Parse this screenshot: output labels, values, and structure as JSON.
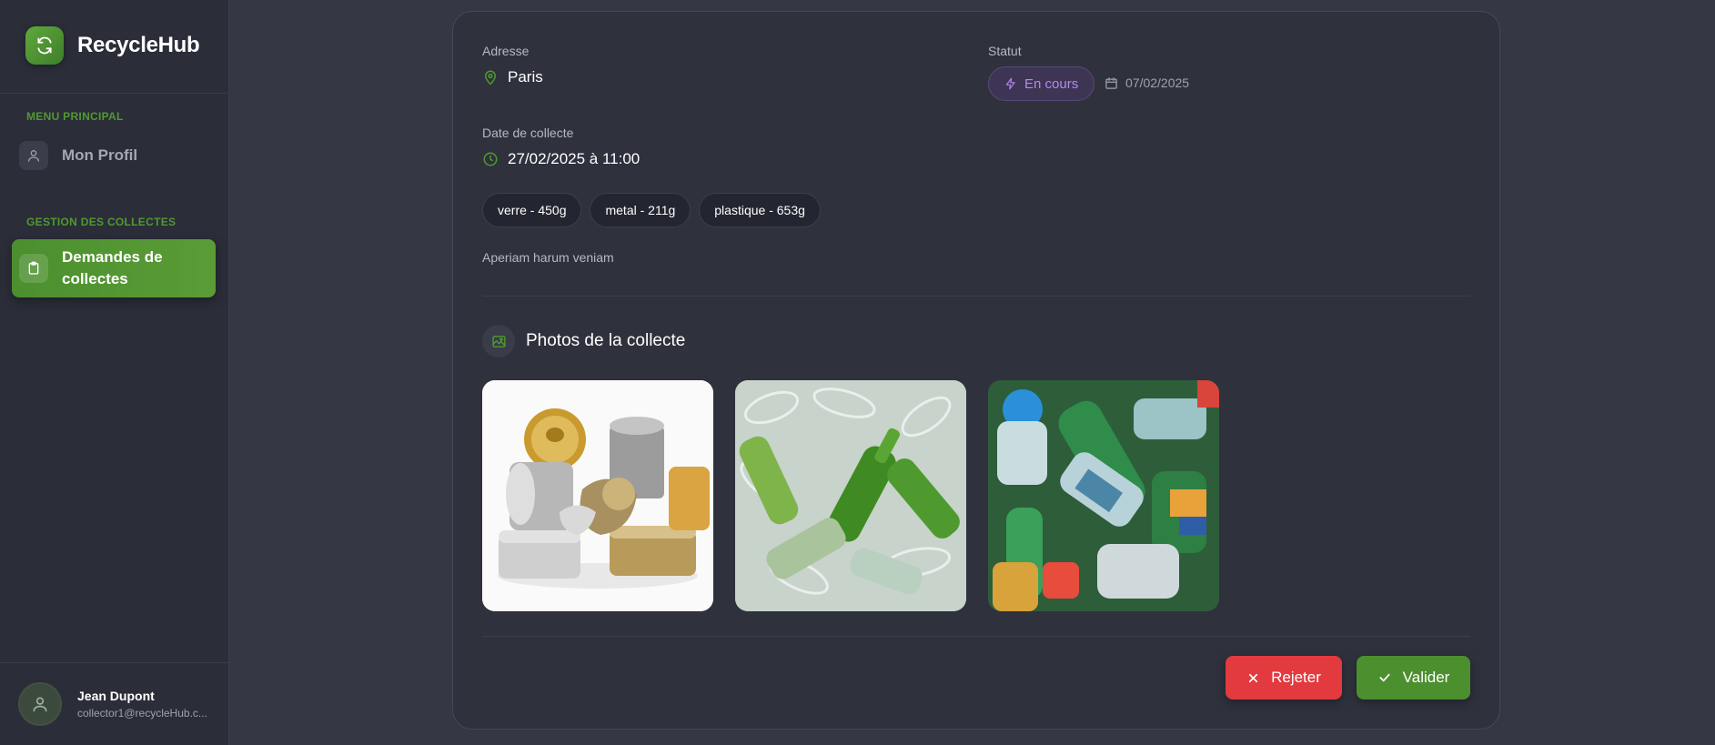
{
  "brand": {
    "name": "RecycleHub",
    "accent": "#4f9a2e"
  },
  "sidebar": {
    "section_main": "MENU PRINCIPAL",
    "profile_label": "Mon Profil",
    "section_collects": "GESTION DES COLLECTES",
    "active_item_label": "Demandes de collectes"
  },
  "user": {
    "name": "Jean Dupont",
    "email": "collector1@recycleHub.c..."
  },
  "request": {
    "address_label": "Adresse",
    "address_value": "Paris",
    "status_label": "Statut",
    "status_value": "En cours",
    "status_color": "#b488f2",
    "created_date": "07/02/2025",
    "collect_date_label": "Date de collecte",
    "collect_date_value": "27/02/2025 à 11:00",
    "materials": [
      {
        "label": "verre - 450g"
      },
      {
        "label": "metal - 211g"
      },
      {
        "label": "plastique - 653g"
      }
    ],
    "description": "Aperiam harum veniam"
  },
  "photos": {
    "title": "Photos de la collecte",
    "items": [
      {
        "name": "metal-cans-photo"
      },
      {
        "name": "glass-bottles-photo"
      },
      {
        "name": "plastic-bottles-photo"
      }
    ]
  },
  "actions": {
    "reject_label": "Rejeter",
    "validate_label": "Valider",
    "reject_color": "#e23a3e",
    "validate_color": "#4c8f2e"
  }
}
